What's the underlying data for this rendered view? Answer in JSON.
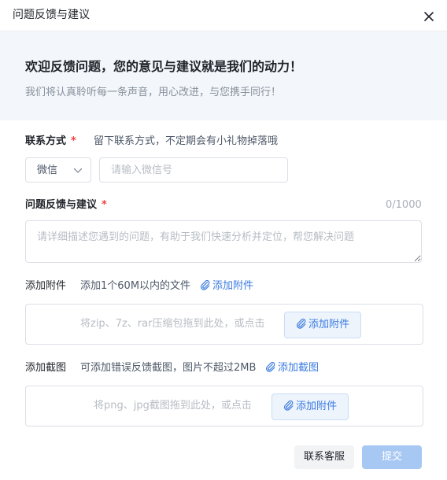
{
  "dialog": {
    "title": "问题反馈与建议"
  },
  "banner": {
    "title": "欢迎反馈问题，您的意见与建议就是我们的动力！",
    "subtitle": "我们将认真聆听每一条声音，用心改进，与您携手同行！"
  },
  "contact": {
    "label": "联系方式",
    "required_mark": "*",
    "hint": "留下联系方式，不定期会有小礼物掉落哦",
    "type_value": "微信",
    "input_placeholder": "请输入微信号",
    "input_value": ""
  },
  "feedback": {
    "label": "问题反馈与建议",
    "required_mark": "*",
    "counter": "0/1000",
    "placeholder": "请详细描述您遇到的问题，有助于我们快速分析并定位，帮您解决问题",
    "value": ""
  },
  "attachment": {
    "label": "添加附件",
    "hint": "添加1个60M以内的文件",
    "link_label": "添加附件",
    "dropzone_text": "将zip、7z、rar压缩包拖到此处，或点击",
    "button_label": "添加附件"
  },
  "screenshot": {
    "label": "添加截图",
    "hint": "可添加错误反馈截图，图片不超过2MB",
    "link_label": "添加截图",
    "dropzone_text": "将png、jpg截图拖到此处，或点击",
    "button_label": "添加附件"
  },
  "footer": {
    "service_label": "联系客服",
    "submit_label": "提交"
  },
  "colors": {
    "accent": "#3b7be0",
    "required": "#f53f3f",
    "submit_disabled": "#a7c8f3",
    "banner_bg": "#f3f6fa"
  },
  "icons": [
    "close-icon",
    "chevron-down-icon",
    "paperclip-icon"
  ]
}
